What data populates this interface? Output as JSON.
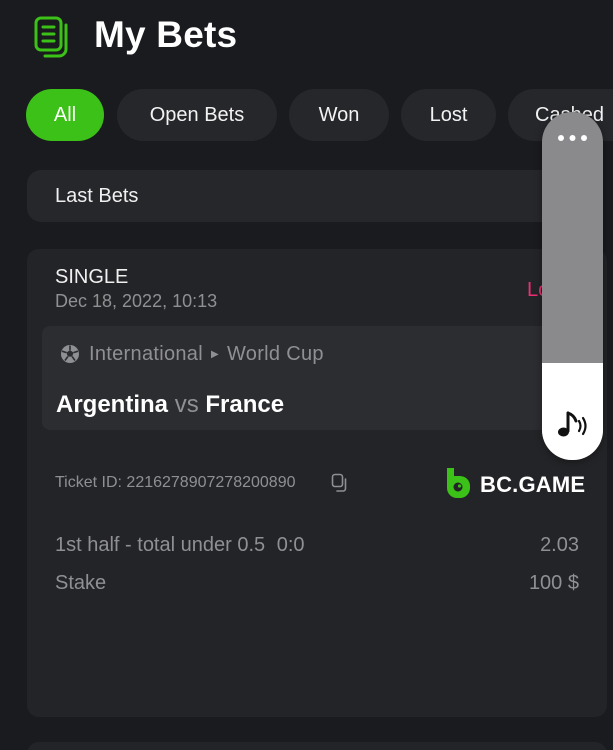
{
  "header": {
    "title": "My Bets",
    "icon": "bets-list-icon"
  },
  "filters": {
    "active": "All",
    "items": [
      {
        "label": "All"
      },
      {
        "label": "Open Bets"
      },
      {
        "label": "Won"
      },
      {
        "label": "Lost"
      },
      {
        "label": "Cashed"
      }
    ]
  },
  "last_bets": {
    "label": "Last Bets"
  },
  "bet": {
    "type": "SINGLE",
    "date": "Dec 18, 2022, 10:13",
    "status": "Lost",
    "league": {
      "sport_icon": "soccer-ball-icon",
      "category": "International",
      "competition": "World Cup"
    },
    "teams": {
      "home": "Argentina",
      "vs": "vs",
      "away": "France"
    },
    "ticket": "Ticket ID: 2216278907278200890",
    "brand": "BC.GAME",
    "selection": {
      "label": "1st half - total under 0.5",
      "score": "0:0",
      "odds": "2.03"
    },
    "stake": {
      "label": "Stake",
      "value": "100 $"
    }
  },
  "volume_panel": {
    "level": 0.28
  },
  "colors": {
    "background": "#1a1b1e",
    "accent": "#3bc117",
    "lost": "#ed2e74",
    "muted": "#8f9093"
  }
}
